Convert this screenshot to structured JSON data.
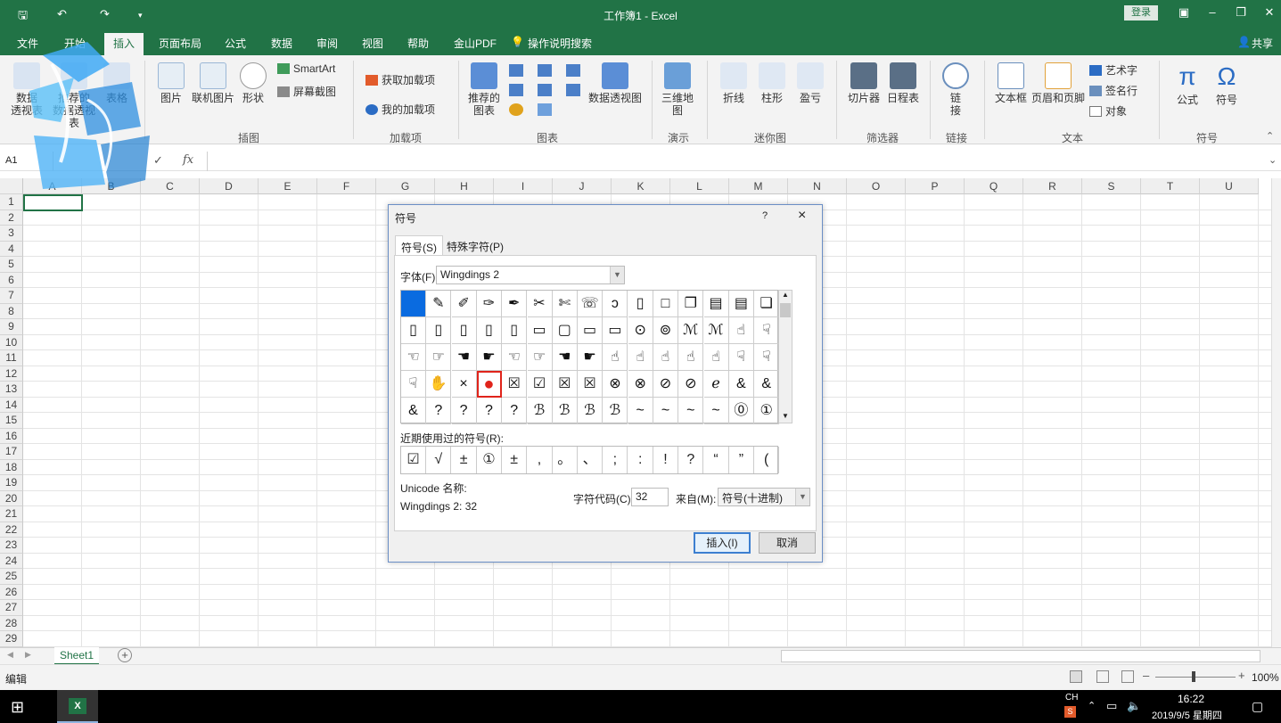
{
  "app": {
    "title": "工作簿1  -  Excel",
    "login_label": "登录",
    "share_label": "共享"
  },
  "ribbon_tabs": [
    "文件",
    "开始",
    "插入",
    "页面布局",
    "公式",
    "数据",
    "审阅",
    "视图",
    "帮助",
    "金山PDF",
    "操作说明搜索"
  ],
  "active_tab": "插入",
  "ribbon": {
    "tables": {
      "pivot": "数据\n透视表",
      "recommended_pivot": "推荐的\n数据透视表",
      "table": "表格"
    },
    "illustrations": {
      "label": "插图",
      "pictures": "图片",
      "online_pictures": "联机图片",
      "shapes": "形状",
      "smartart": "SmartArt",
      "screenshot": "屏幕截图"
    },
    "addins": {
      "label": "加载项",
      "get": "获取加载项",
      "my": "我的加载项"
    },
    "charts": {
      "label": "图表",
      "recommended": "推荐的\n图表",
      "pivot_chart": "数据透视图"
    },
    "tours": {
      "label": "演示",
      "map3d": "三维地\n图"
    },
    "sparklines": {
      "label": "迷你图",
      "line": "折线",
      "column": "柱形",
      "winloss": "盈亏"
    },
    "filters": {
      "label": "筛选器",
      "slicer": "切片器",
      "timeline": "日程表"
    },
    "links": {
      "label": "链接",
      "link": "链\n接"
    },
    "text": {
      "label": "文本",
      "textbox": "文本框",
      "header_footer": "页眉和页脚",
      "wordart": "艺术字",
      "signature": "签名行",
      "object": "对象"
    },
    "symbols": {
      "label": "符号",
      "equation": "公式",
      "symbol": "符号"
    }
  },
  "formula_bar": {
    "name_box": "A1",
    "fx": "fx",
    "content": ""
  },
  "columns": [
    "A",
    "B",
    "C",
    "D",
    "E",
    "F",
    "G",
    "H",
    "I",
    "J",
    "K",
    "L",
    "M",
    "N",
    "O",
    "P",
    "Q",
    "R",
    "S",
    "T",
    "U"
  ],
  "rows": [
    "1",
    "2",
    "3",
    "4",
    "5",
    "6",
    "7",
    "8",
    "9",
    "10",
    "11",
    "12",
    "13",
    "14",
    "15",
    "16",
    "17",
    "18",
    "19",
    "20",
    "21",
    "22",
    "23",
    "24",
    "25",
    "26",
    "27",
    "28",
    "29"
  ],
  "sheet_tab": "Sheet1",
  "status": {
    "mode": "编辑",
    "zoom": "100%"
  },
  "taskbar": {
    "time": "16:22",
    "date": "2019/9/5 星期四",
    "ime": "CH"
  },
  "dialog": {
    "title": "符号",
    "help": "?",
    "close": "×",
    "tab_symbols": "符号(S)",
    "tab_special": "特殊字符(P)",
    "font_label": "字体(F):",
    "font_value": "Wingdings 2",
    "symbol_rows": [
      [
        "",
        "✎",
        "✐",
        "✑",
        "✒",
        "✂",
        "✄",
        "☏",
        "ɔ",
        "▯",
        "□",
        "❐",
        "▤",
        "▤",
        "❏"
      ],
      [
        "▯",
        "▯",
        "▯",
        "▯",
        "▯",
        "▭",
        "▢",
        "▭",
        "▭",
        "⊙",
        "⊚",
        "ℳ",
        "ℳ",
        "☝",
        "☟"
      ],
      [
        "☜",
        "☞",
        "☚",
        "☛",
        "☜",
        "☞",
        "☚",
        "☛",
        "☝",
        "☝",
        "☝",
        "☝",
        "☝",
        "☟",
        "☟"
      ],
      [
        "☟",
        "✋",
        "×",
        "●",
        "☒",
        "☑",
        "☒",
        "☒",
        "⊗",
        "⊗",
        "⊘",
        "⊘",
        "ℯ",
        "&",
        "&"
      ],
      [
        "&",
        "?",
        "?",
        "?",
        "?",
        "ℬ",
        "ℬ",
        "ℬ",
        "ℬ",
        "~",
        "~",
        "~",
        "~",
        "⓪",
        "①"
      ]
    ],
    "recent_label": "近期使用过的符号(R):",
    "recent_symbols": [
      "☑",
      "√",
      "±",
      "①",
      "±",
      ",",
      "。",
      "、",
      ";",
      ":",
      "!",
      "?",
      "“",
      "”",
      "("
    ],
    "unicode_label": "Unicode 名称:",
    "unicode_value": "Wingdings 2: 32",
    "charcode_label": "字符代码(C):",
    "charcode_value": "32",
    "from_label": "来自(M):",
    "from_value": "符号(十进制)",
    "insert_button": "插入(I)",
    "cancel_button": "取消"
  },
  "colors": {
    "excel_green": "#217346",
    "selection_blue": "#0a6be0",
    "highlight_red": "#e0241b"
  }
}
